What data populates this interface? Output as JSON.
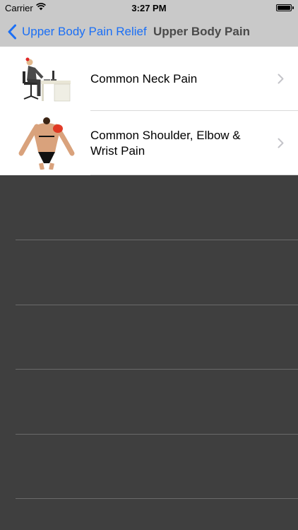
{
  "status_bar": {
    "carrier": "Carrier",
    "time": "3:27 PM",
    "wifi_icon": "wifi-icon",
    "battery_icon": "battery-icon",
    "battery_level": 1.0
  },
  "nav": {
    "back_label": "Upper Body Pain Relief",
    "title": "Upper Body Pain",
    "accent": "#1b6ff5"
  },
  "list": {
    "items": [
      {
        "label": "Common Neck Pain",
        "icon": "desk-worker-neck-pain-image"
      },
      {
        "label": "Common Shoulder, Elbow & Wrist Pain",
        "icon": "shoulder-pain-back-image"
      }
    ]
  }
}
